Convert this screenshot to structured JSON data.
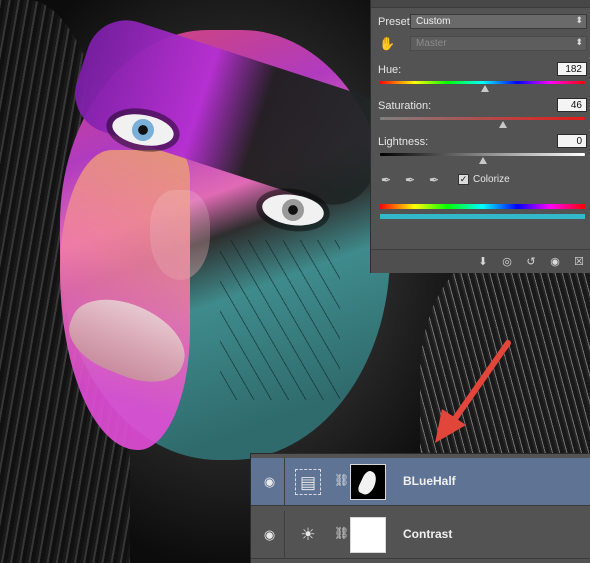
{
  "properties_panel": {
    "preset_label": "Preset:",
    "preset_value": "Custom",
    "channel_value": "Master",
    "hue": {
      "label": "Hue:",
      "value": "182",
      "fraction": 0.51
    },
    "saturation": {
      "label": "Saturation:",
      "value": "46",
      "fraction": 0.6
    },
    "lightness": {
      "label": "Lightness:",
      "value": "0",
      "fraction": 0.5
    },
    "colorize_label": "Colorize",
    "colorize_checked": true,
    "colorize_color": "#32b8c8"
  },
  "layers_panel": {
    "layers": [
      {
        "name": "BLueHalf",
        "selected": true,
        "type": "hue-saturation",
        "mask": "black"
      },
      {
        "name": "Contrast",
        "selected": false,
        "type": "brightness-contrast",
        "mask": "white"
      }
    ]
  },
  "annotation": {
    "arrow_color": "#e2453a"
  }
}
